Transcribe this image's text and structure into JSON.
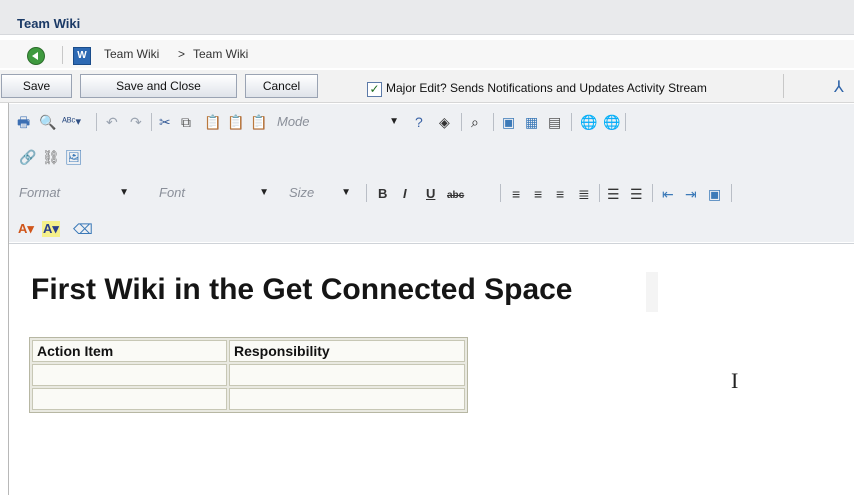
{
  "app": {
    "title": "Team Wiki"
  },
  "breadcrumb": {
    "root": "Team Wiki",
    "separator": ">",
    "current": "Team Wiki"
  },
  "actions": {
    "save": "Save",
    "save_close": "Save and Close",
    "cancel": "Cancel",
    "major_edit_label": "Major Edit? Sends Notifications and Updates Activity Stream",
    "major_edit_checked": true
  },
  "toolbar": {
    "mode": "Mode",
    "format": "Format",
    "font": "Font",
    "size": "Size",
    "bold": "B",
    "italic": "I",
    "underline": "U",
    "strike": "abc",
    "text_color": "A",
    "bg_color": "A",
    "icons": [
      "print-icon",
      "preview-icon",
      "spellcheck-icon",
      "undo-icon",
      "redo-icon",
      "cut-icon",
      "copy-icon",
      "paste-icon",
      "paste-text-icon",
      "paste-word-icon",
      "help-icon",
      "maximize-icon",
      "find-icon",
      "image-icon",
      "table-icon",
      "horizontal-rule-icon",
      "link-icon",
      "unlink-icon",
      "anchor-icon",
      "align-left-icon",
      "align-center-icon",
      "align-right-icon",
      "justify-icon",
      "numbered-list-icon",
      "bulleted-list-icon",
      "outdent-icon",
      "indent-icon",
      "insert-template-icon",
      "eraser-icon"
    ]
  },
  "content": {
    "heading": "First Wiki in the Get Connected Space",
    "table": {
      "headers": [
        "Action Item",
        "Responsibility"
      ],
      "rows": [
        [
          "",
          ""
        ],
        [
          "",
          ""
        ]
      ]
    }
  }
}
